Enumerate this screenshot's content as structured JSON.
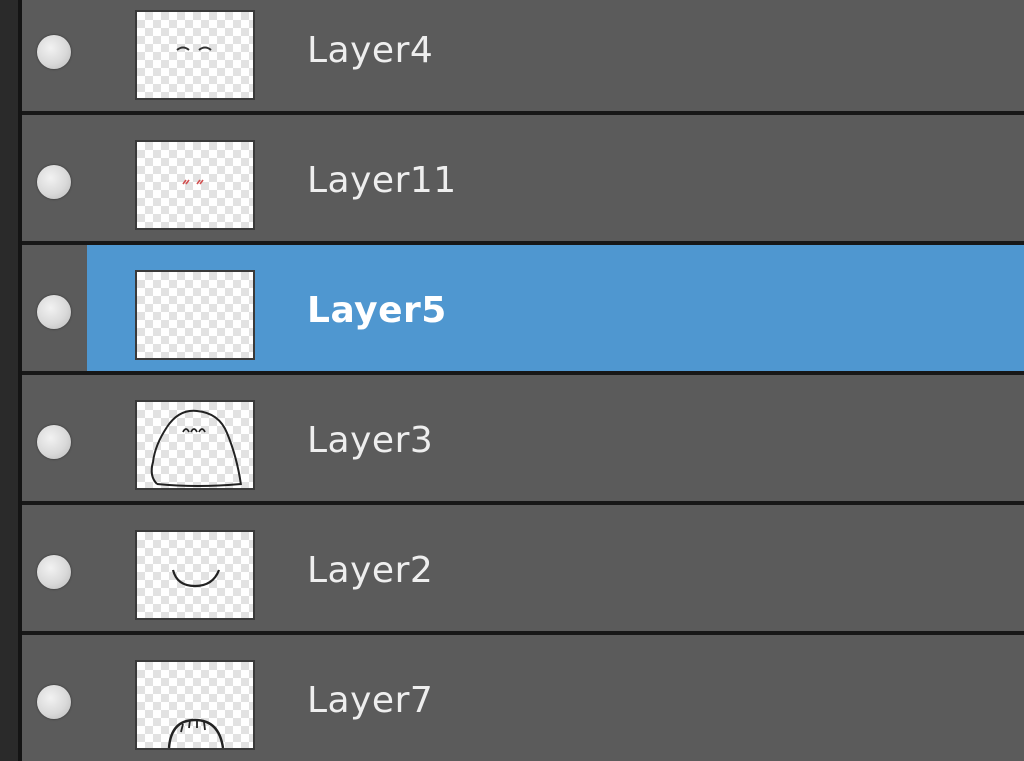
{
  "layers_panel": {
    "layers": [
      {
        "name": "Layer4",
        "selected": false,
        "visible": true,
        "thumbnail": "eyebrows-sketch"
      },
      {
        "name": "Layer11",
        "selected": false,
        "visible": true,
        "thumbnail": "red-marks-sketch"
      },
      {
        "name": "Layer5",
        "selected": true,
        "visible": true,
        "thumbnail": "empty"
      },
      {
        "name": "Layer3",
        "selected": false,
        "visible": true,
        "thumbnail": "head-outline-sketch"
      },
      {
        "name": "Layer2",
        "selected": false,
        "visible": true,
        "thumbnail": "mouth-sketch"
      },
      {
        "name": "Layer7",
        "selected": false,
        "visible": true,
        "thumbnail": "hair-sketch"
      }
    ]
  },
  "colors": {
    "row_background": "#5b5b5b",
    "selected_background": "#4f97d0",
    "separator": "#171717",
    "text": "#eeeeee"
  }
}
